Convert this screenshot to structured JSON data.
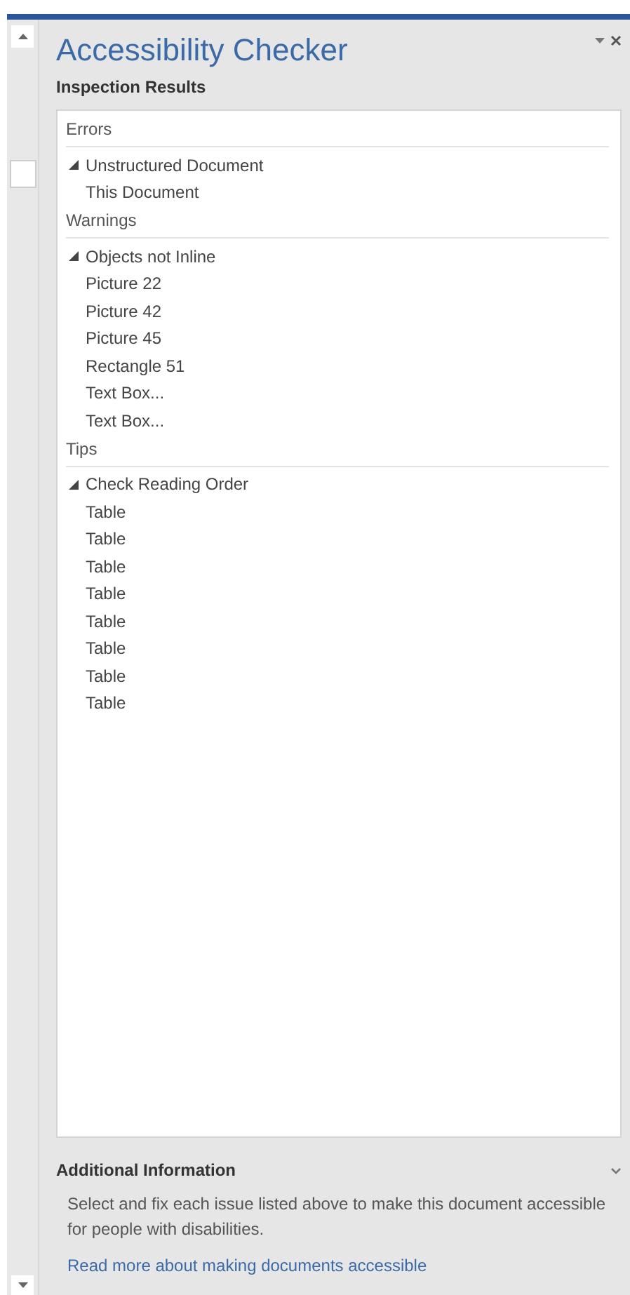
{
  "pane": {
    "title": "Accessibility Checker",
    "subtitle": "Inspection Results"
  },
  "sections": [
    {
      "title": "Errors",
      "groups": [
        {
          "label": "Unstructured Document",
          "expanded": true,
          "children": [
            {
              "label": "This Document"
            }
          ]
        }
      ]
    },
    {
      "title": "Warnings",
      "groups": [
        {
          "label": "Objects not Inline",
          "expanded": true,
          "children": [
            {
              "label": "Picture 22"
            },
            {
              "label": "Picture 42"
            },
            {
              "label": "Picture 45"
            },
            {
              "label": "Rectangle 51"
            },
            {
              "label": "Text Box..."
            },
            {
              "label": "Text Box..."
            }
          ]
        }
      ]
    },
    {
      "title": "Tips",
      "groups": [
        {
          "label": "Check Reading Order",
          "expanded": true,
          "children": [
            {
              "label": "Table"
            },
            {
              "label": "Table"
            },
            {
              "label": "Table"
            },
            {
              "label": "Table"
            },
            {
              "label": "Table"
            },
            {
              "label": "Table"
            },
            {
              "label": "Table"
            },
            {
              "label": "Table"
            }
          ]
        }
      ]
    }
  ],
  "additional_info": {
    "title": "Additional Information",
    "expanded": true,
    "text": "Select and fix each issue listed above to make this document accessible for people with disabilities.",
    "link": "Read more about making documents accessible"
  }
}
